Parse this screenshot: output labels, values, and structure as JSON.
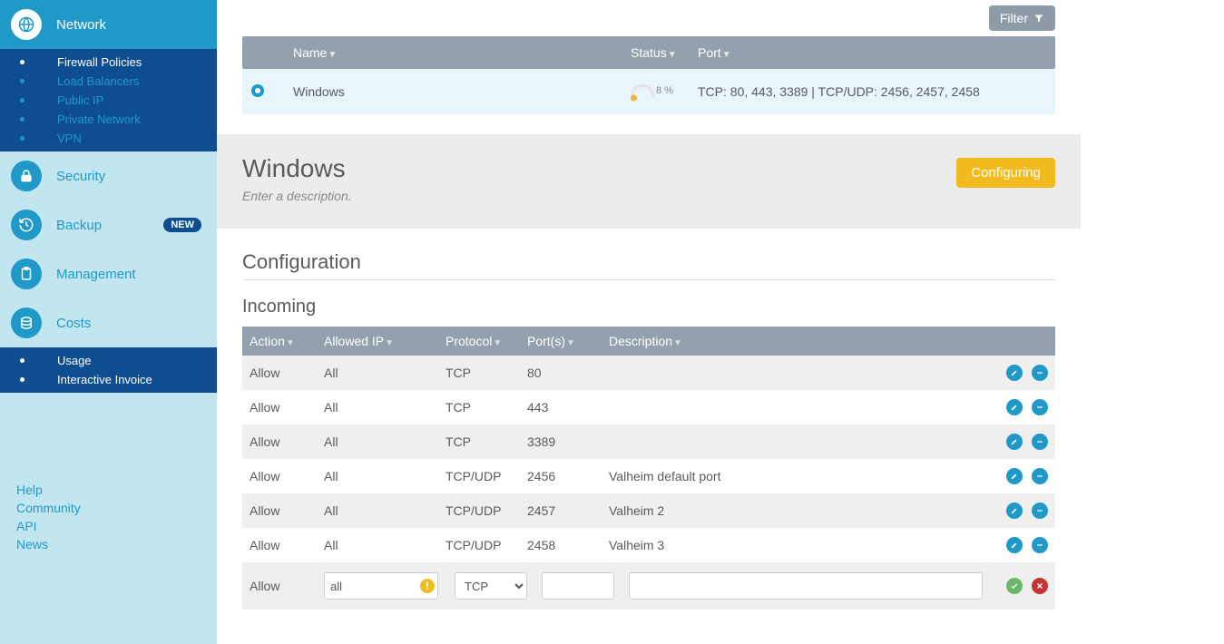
{
  "sidebar": {
    "network": {
      "label": "Network",
      "items": [
        {
          "label": "Firewall Policies",
          "current": true
        },
        {
          "label": "Load Balancers"
        },
        {
          "label": "Public IP"
        },
        {
          "label": "Private Network"
        },
        {
          "label": "VPN"
        }
      ]
    },
    "security": {
      "label": "Security"
    },
    "backup": {
      "label": "Backup",
      "badge": "NEW"
    },
    "management": {
      "label": "Management"
    },
    "costs": {
      "label": "Costs",
      "items": [
        {
          "label": "Usage"
        },
        {
          "label": "Interactive Invoice"
        }
      ]
    }
  },
  "footerLinks": [
    "Help",
    "Community",
    "API",
    "News"
  ],
  "filter_label": "Filter",
  "policies": {
    "headers": {
      "name": "Name",
      "status": "Status",
      "port": "Port"
    },
    "row": {
      "name": "Windows",
      "status_pct": "8 %",
      "ports": "TCP: 80, 443, 3389 | TCP/UDP: 2456, 2457, 2458"
    }
  },
  "detail": {
    "title": "Windows",
    "desc_placeholder": "Enter a description.",
    "status_btn": "Configuring",
    "config_heading": "Configuration",
    "incoming_heading": "Incoming"
  },
  "rules": {
    "headers": {
      "action": "Action",
      "ip": "Allowed IP",
      "proto": "Protocol",
      "ports": "Port(s)",
      "desc": "Description"
    },
    "rows": [
      {
        "action": "Allow",
        "ip": "All",
        "proto": "TCP",
        "port": "80",
        "desc": ""
      },
      {
        "action": "Allow",
        "ip": "All",
        "proto": "TCP",
        "port": "443",
        "desc": ""
      },
      {
        "action": "Allow",
        "ip": "All",
        "proto": "TCP",
        "port": "3389",
        "desc": ""
      },
      {
        "action": "Allow",
        "ip": "All",
        "proto": "TCP/UDP",
        "port": "2456",
        "desc": "Valheim default port"
      },
      {
        "action": "Allow",
        "ip": "All",
        "proto": "TCP/UDP",
        "port": "2457",
        "desc": "Valheim 2"
      },
      {
        "action": "Allow",
        "ip": "All",
        "proto": "TCP/UDP",
        "port": "2458",
        "desc": "Valheim 3"
      }
    ],
    "new_row": {
      "action": "Allow",
      "ip_value": "all",
      "proto_value": "TCP",
      "port_value": "",
      "desc_value": ""
    }
  }
}
